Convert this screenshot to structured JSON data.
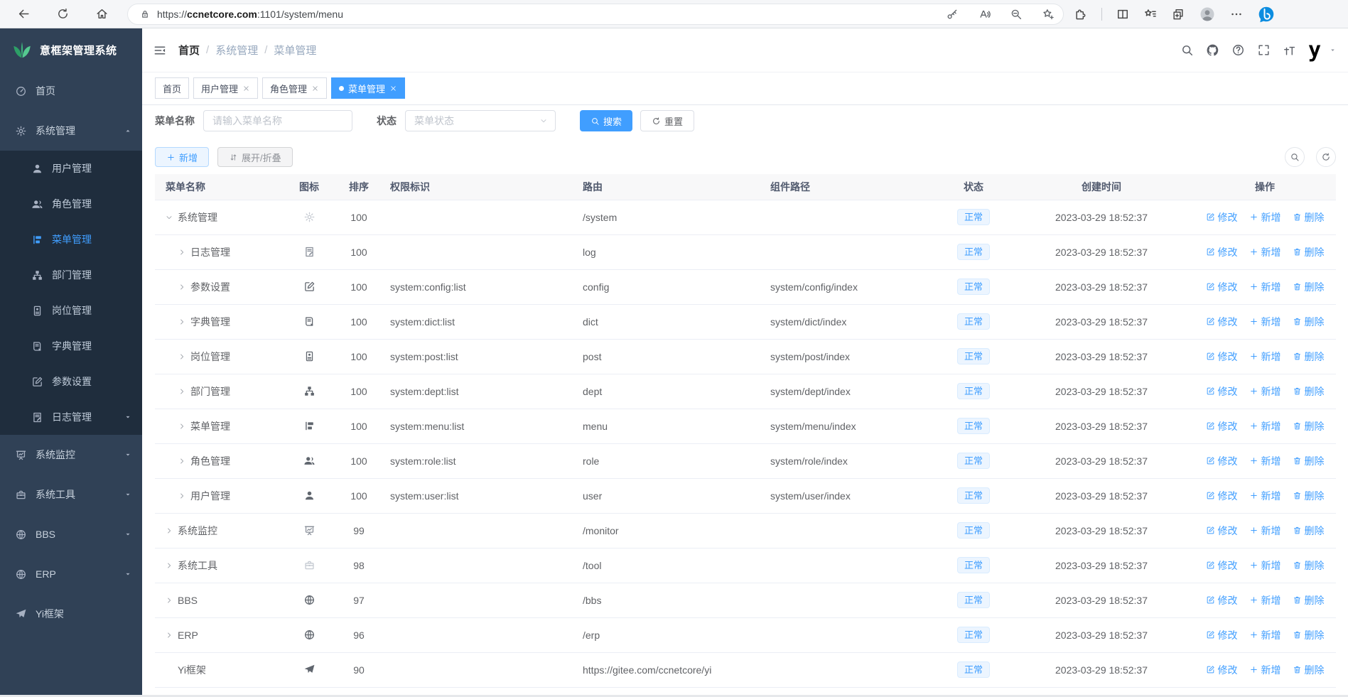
{
  "colors": {
    "accent": "#409eff",
    "sidebar_bg": "#304156",
    "submenu_bg": "#1f2d3d",
    "status_badge_bg": "#ecf5ff"
  },
  "browser": {
    "url_scheme": "https://",
    "url_host": "ccnetcore.com",
    "url_rest": ":1101/system/menu",
    "nav_icons": [
      "back-icon",
      "refresh-icon",
      "home-icon"
    ],
    "pill_left_icon": "lock-icon",
    "pill_right_icons": [
      "key-icon",
      "read-aloud-icon",
      "zoom-out-icon",
      "favorite-add-icon"
    ],
    "right_icons": [
      "extensions-icon",
      "split-screen-icon",
      "favorites-bar-icon",
      "collections-icon",
      "profile-avatar-icon",
      "more-icon",
      "bing-icon"
    ]
  },
  "sidebar": {
    "logo_icon": "leaf-logo-icon",
    "logo_title": "意框架管理系统",
    "items": [
      {
        "key": "home",
        "label": "首页",
        "icon": "dashboard-icon"
      },
      {
        "key": "system",
        "label": "系统管理",
        "icon": "gear-icon",
        "expanded": true,
        "children": [
          {
            "key": "user",
            "label": "用户管理",
            "icon": "user-icon"
          },
          {
            "key": "role",
            "label": "角色管理",
            "icon": "users-icon"
          },
          {
            "key": "menu",
            "label": "菜单管理",
            "icon": "menu-tree-icon",
            "active": true
          },
          {
            "key": "dept",
            "label": "部门管理",
            "icon": "org-tree-icon"
          },
          {
            "key": "post",
            "label": "岗位管理",
            "icon": "post-badge-icon"
          },
          {
            "key": "dict",
            "label": "字典管理",
            "icon": "dict-book-icon"
          },
          {
            "key": "config",
            "label": "参数设置",
            "icon": "config-edit-icon"
          },
          {
            "key": "log",
            "label": "日志管理",
            "icon": "log-edit-icon",
            "has_caret": true
          }
        ]
      },
      {
        "key": "monitor",
        "label": "系统监控",
        "icon": "monitor-icon",
        "has_caret": true
      },
      {
        "key": "tool",
        "label": "系统工具",
        "icon": "toolbox-icon",
        "has_caret": true
      },
      {
        "key": "bbs",
        "label": "BBS",
        "icon": "globe-icon",
        "has_caret": true
      },
      {
        "key": "erp",
        "label": "ERP",
        "icon": "globe-icon",
        "has_caret": true
      },
      {
        "key": "yi",
        "label": "Yi框架",
        "icon": "paper-plane-icon"
      }
    ]
  },
  "navbar": {
    "breadcrumb": [
      "首页",
      "系统管理",
      "菜单管理"
    ],
    "breadcrumb_separator": "/",
    "icons": [
      "search-icon",
      "github-icon",
      "question-icon",
      "fullscreen-icon",
      "text-size-icon"
    ],
    "user_logo_text": "y"
  },
  "tabs": [
    {
      "label": "首页",
      "closable": false,
      "active": false
    },
    {
      "label": "用户管理",
      "closable": true,
      "active": false
    },
    {
      "label": "角色管理",
      "closable": true,
      "active": false
    },
    {
      "label": "菜单管理",
      "closable": true,
      "active": true
    }
  ],
  "filters": {
    "name_label": "菜单名称",
    "name_placeholder": "请输入菜单名称",
    "status_label": "状态",
    "status_placeholder": "菜单状态",
    "search_label": "搜索",
    "reset_label": "重置"
  },
  "toolbar": {
    "add_label": "新增",
    "toggle_label": "展开/折叠",
    "icon_buttons": [
      "search-icon",
      "refresh-icon"
    ]
  },
  "table": {
    "columns": [
      "菜单名称",
      "图标",
      "排序",
      "权限标识",
      "路由",
      "组件路径",
      "状态",
      "创建时间",
      "操作"
    ],
    "actions": [
      {
        "key": "edit",
        "label": "修改",
        "icon": "edit-action-icon"
      },
      {
        "key": "add",
        "label": "新增",
        "icon": "plus-icon"
      },
      {
        "key": "delete",
        "label": "删除",
        "icon": "trash-icon"
      }
    ],
    "rows": [
      {
        "name": "系统管理",
        "level": 0,
        "expand": "open",
        "icon": "gear-icon",
        "sort": "100",
        "perms": "",
        "route": "/system",
        "component": "",
        "status": "正常",
        "created": "2023-03-29 18:52:37"
      },
      {
        "name": "日志管理",
        "level": 1,
        "expand": "closed",
        "icon": "log-edit-icon",
        "sort": "100",
        "perms": "",
        "route": "log",
        "component": "",
        "status": "正常",
        "created": "2023-03-29 18:52:37"
      },
      {
        "name": "参数设置",
        "level": 1,
        "expand": "closed",
        "icon": "config-edit-icon",
        "sort": "100",
        "perms": "system:config:list",
        "route": "config",
        "component": "system/config/index",
        "status": "正常",
        "created": "2023-03-29 18:52:37"
      },
      {
        "name": "字典管理",
        "level": 1,
        "expand": "closed",
        "icon": "dict-book-icon",
        "sort": "100",
        "perms": "system:dict:list",
        "route": "dict",
        "component": "system/dict/index",
        "status": "正常",
        "created": "2023-03-29 18:52:37"
      },
      {
        "name": "岗位管理",
        "level": 1,
        "expand": "closed",
        "icon": "post-badge-icon",
        "sort": "100",
        "perms": "system:post:list",
        "route": "post",
        "component": "system/post/index",
        "status": "正常",
        "created": "2023-03-29 18:52:37"
      },
      {
        "name": "部门管理",
        "level": 1,
        "expand": "closed",
        "icon": "org-tree-icon",
        "sort": "100",
        "perms": "system:dept:list",
        "route": "dept",
        "component": "system/dept/index",
        "status": "正常",
        "created": "2023-03-29 18:52:37"
      },
      {
        "name": "菜单管理",
        "level": 1,
        "expand": "closed",
        "icon": "menu-tree-icon",
        "sort": "100",
        "perms": "system:menu:list",
        "route": "menu",
        "component": "system/menu/index",
        "status": "正常",
        "created": "2023-03-29 18:52:37"
      },
      {
        "name": "角色管理",
        "level": 1,
        "expand": "closed",
        "icon": "users-icon",
        "sort": "100",
        "perms": "system:role:list",
        "route": "role",
        "component": "system/role/index",
        "status": "正常",
        "created": "2023-03-29 18:52:37"
      },
      {
        "name": "用户管理",
        "level": 1,
        "expand": "closed",
        "icon": "user-icon",
        "sort": "100",
        "perms": "system:user:list",
        "route": "user",
        "component": "system/user/index",
        "status": "正常",
        "created": "2023-03-29 18:52:37"
      },
      {
        "name": "系统监控",
        "level": 0,
        "expand": "closed",
        "icon": "monitor-icon",
        "sort": "99",
        "perms": "",
        "route": "/monitor",
        "component": "",
        "status": "正常",
        "created": "2023-03-29 18:52:37"
      },
      {
        "name": "系统工具",
        "level": 0,
        "expand": "closed",
        "icon": "toolbox-icon",
        "sort": "98",
        "perms": "",
        "route": "/tool",
        "component": "",
        "status": "正常",
        "created": "2023-03-29 18:52:37"
      },
      {
        "name": "BBS",
        "level": 0,
        "expand": "closed",
        "icon": "globe-icon",
        "sort": "97",
        "perms": "",
        "route": "/bbs",
        "component": "",
        "status": "正常",
        "created": "2023-03-29 18:52:37"
      },
      {
        "name": "ERP",
        "level": 0,
        "expand": "closed",
        "icon": "globe-icon",
        "sort": "96",
        "perms": "",
        "route": "/erp",
        "component": "",
        "status": "正常",
        "created": "2023-03-29 18:52:37"
      },
      {
        "name": "Yi框架",
        "level": 0,
        "expand": "none",
        "icon": "paper-plane-icon",
        "sort": "90",
        "perms": "",
        "route": "https://gitee.com/ccnetcore/yi",
        "component": "",
        "status": "正常",
        "created": "2023-03-29 18:52:37"
      }
    ]
  }
}
